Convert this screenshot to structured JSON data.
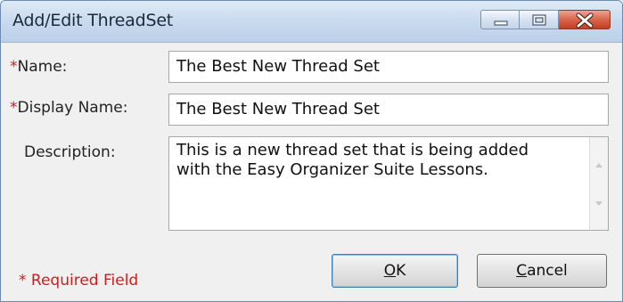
{
  "window": {
    "title": "Add/Edit ThreadSet",
    "controls": {
      "minimize": "minimize",
      "maximize": "maximize",
      "close": "close"
    }
  },
  "form": {
    "required_marker": "*",
    "name": {
      "label": "Name:",
      "value": "The Best New Thread Set"
    },
    "display_name": {
      "label": "Display Name:",
      "value": "The Best New Thread Set"
    },
    "description": {
      "label": "Description:",
      "value": "This is a new thread set that is being added with the Easy Organizer Suite Lessons."
    }
  },
  "buttons": {
    "ok": {
      "first": "O",
      "rest": "K"
    },
    "cancel": {
      "first": "C",
      "rest": "ancel"
    }
  },
  "footer": {
    "required_note": "* Required Field"
  },
  "icons": [
    "minimize-icon",
    "maximize-icon",
    "close-icon",
    "scroll-up-icon",
    "scroll-down-icon"
  ],
  "colors": {
    "required": "#d01c1c",
    "close_button": "#c43e22",
    "titlebar": "#c7d9ee"
  }
}
